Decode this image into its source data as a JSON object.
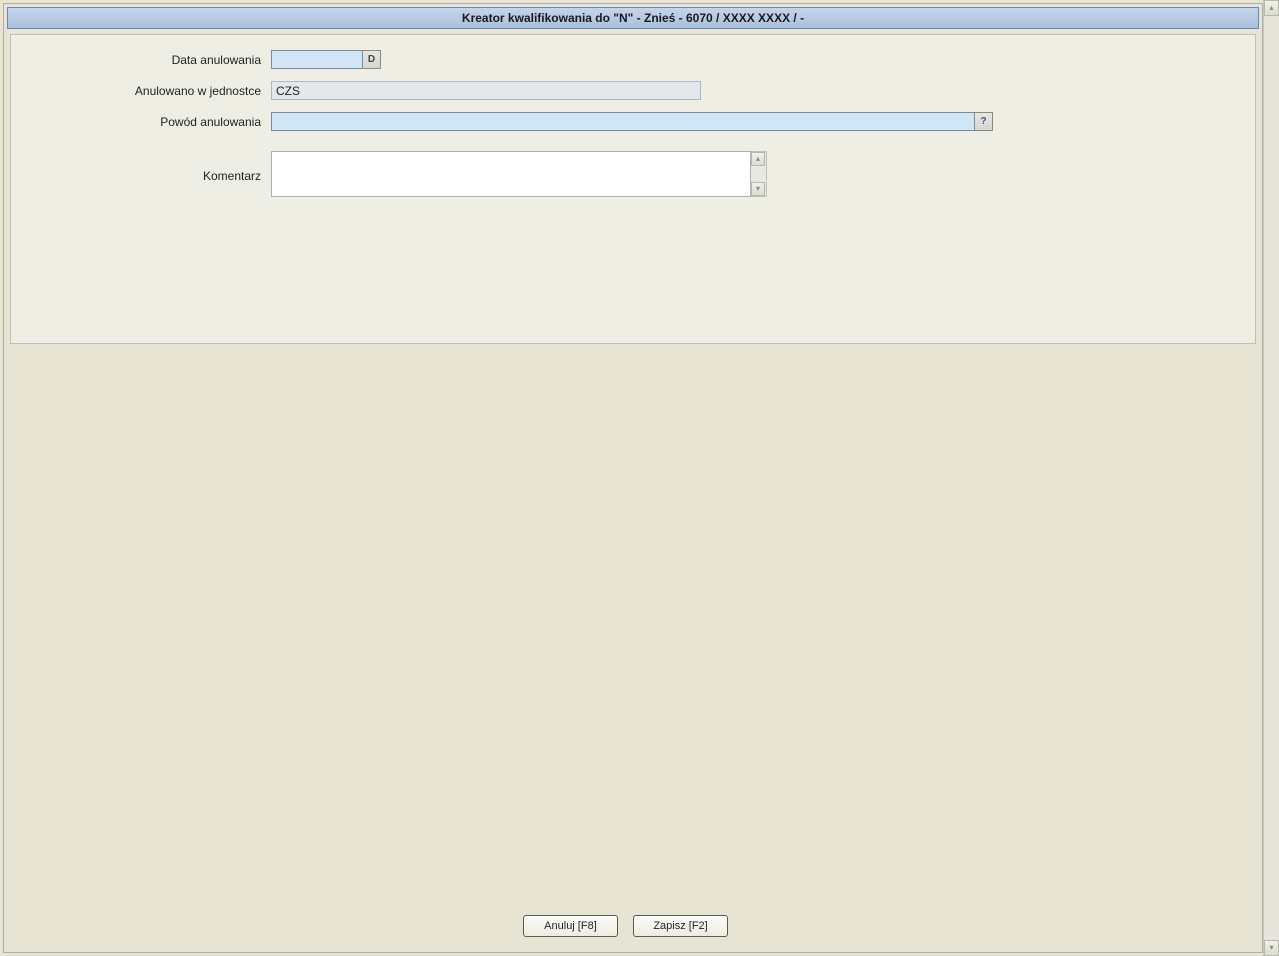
{
  "window": {
    "title": "Kreator kwalifikowania do \"N\" - Znieś - 6070 / XXXX XXXX / -"
  },
  "form": {
    "cancel_date_label": "Data anulowania",
    "cancel_date_value": "",
    "date_picker_btn": "D",
    "cancelled_in_unit_label": "Anulowano w jednostce",
    "cancelled_in_unit_value": "CZS",
    "reason_label": "Powód anulowania",
    "reason_value": "",
    "reason_lookup_btn": "?",
    "comment_label": "Komentarz",
    "comment_value": ""
  },
  "buttons": {
    "cancel": "Anuluj [F8]",
    "save": "Zapisz [F2]"
  }
}
